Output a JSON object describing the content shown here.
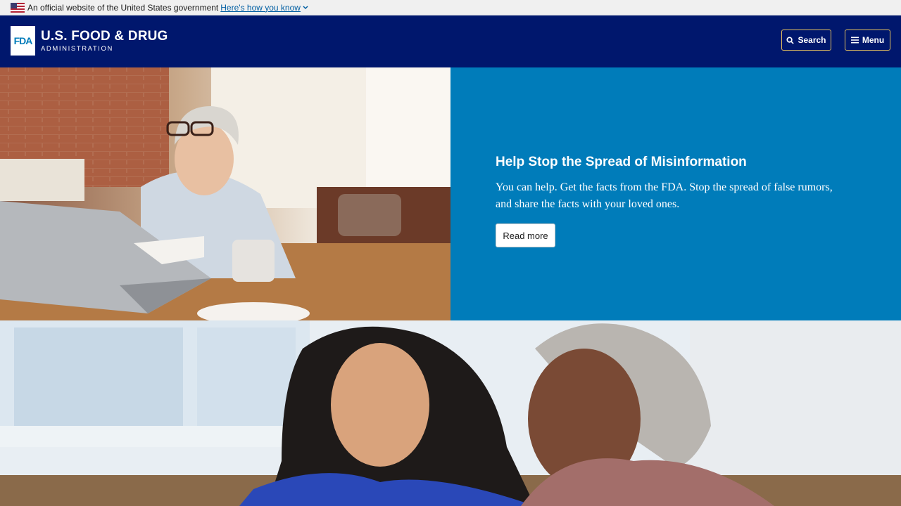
{
  "gov_banner": {
    "text": "An official website of the United States government",
    "link_label": "Here's how you know"
  },
  "header": {
    "logo_mark": "FDA",
    "logo_main": "U.S. FOOD & DRUG",
    "logo_sub": "ADMINISTRATION",
    "search_label": "Search",
    "menu_label": "Menu"
  },
  "hero": {
    "title": "Help Stop the Spread of Misinformation",
    "description": "You can help. Get the facts from the FDA. Stop the spread of false rumors, and share the facts with your loved ones.",
    "button_label": "Read more"
  },
  "colors": {
    "gov_banner_bg": "#f0f0f0",
    "header_bg": "#00176d",
    "header_button_border": "#e5c15e",
    "hero_panel_bg": "#007cba",
    "link": "#005ea2"
  },
  "icons": {
    "flag": "us-flag-icon",
    "search": "search-icon",
    "menu": "hamburger-icon",
    "chevron": "chevron-down-icon"
  }
}
